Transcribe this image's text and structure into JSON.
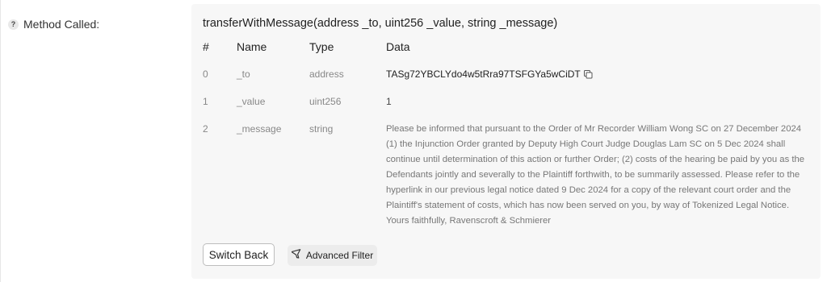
{
  "field_label": "Method Called:",
  "help_glyph": "?",
  "method_signature": "transferWithMessage(address _to, uint256 _value, string _message)",
  "table": {
    "headers": [
      "#",
      "Name",
      "Type",
      "Data"
    ],
    "rows": [
      {
        "index": "0",
        "name": "_to",
        "type": "address",
        "data": "TASg72YBCLYdo4w5tRra97TSFGYa5wCiDT"
      },
      {
        "index": "1",
        "name": "_value",
        "type": "uint256",
        "data": "1"
      },
      {
        "index": "2",
        "name": "_message",
        "type": "string",
        "data": "Please be informed that pursuant to the Order of Mr Recorder William Wong SC on 27 December 2024 (1) the Injunction Order granted by Deputy High Court Judge Douglas Lam SC on 5 Dec 2024 shall continue until determination of this action or further Order; (2) costs of the hearing be paid by you as the Defendants jointly and severally to the Plaintiff forthwith, to be summarily assessed. Please refer to the hyperlink in our previous legal notice dated 9 Dec 2024 for a copy of the relevant court order and the Plaintiff's statement of costs, which has now been served on you, by way of Tokenized Legal Notice. Yours faithfully, Ravenscroft & Schmierer"
      }
    ]
  },
  "buttons": {
    "switch_back": "Switch Back",
    "advanced_filter": "Advanced Filter"
  },
  "icons": {
    "help": "help-icon",
    "copy": "copy-icon",
    "filter": "filter-icon"
  }
}
